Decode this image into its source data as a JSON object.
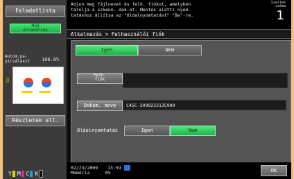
{
  "left": {
    "job_list_label": "Feladatlista",
    "check_label": "Mód\nellenőrzés",
    "auto_label": "Autom.pa-\npírválaszt",
    "auto_value": "100.0%",
    "details_label": "Részletek ell.",
    "toner": [
      "Y",
      "M",
      "C",
      "K"
    ]
  },
  "header": {
    "message": "Adjon meg fájlnevet és felh. fiókot, amelyben\ntárolja a szkenn. dok-ot. Mentés alatti nyom-\ntatáshoz állítsa az \"Oldalnyomtatást\" \"Be\"-re.",
    "copies_label": "Szettek\nszáma",
    "copies_value": "1"
  },
  "breadcrumb": "Alkalmazás > Felhasználói fiók",
  "tabs": {
    "yes": "Igen",
    "no": "Nem"
  },
  "fields": {
    "user_box_label": "Felh.\nfiók",
    "user_box_value": "",
    "doc_name_label": "Dokum. neve",
    "doc_name_value": "C45C-3090223135900",
    "duplex_label": "Oldalnyomtatás",
    "duplex_yes": "Igen",
    "duplex_no": "Nem"
  },
  "footer": {
    "date": "02/23/2009",
    "time": "13:59",
    "memory_label": "Memória",
    "memory_value": "0%",
    "ok_label": "OK"
  },
  "colors": {
    "accent_green": "#2ad25a",
    "bg_orange": "#f2c27d"
  }
}
